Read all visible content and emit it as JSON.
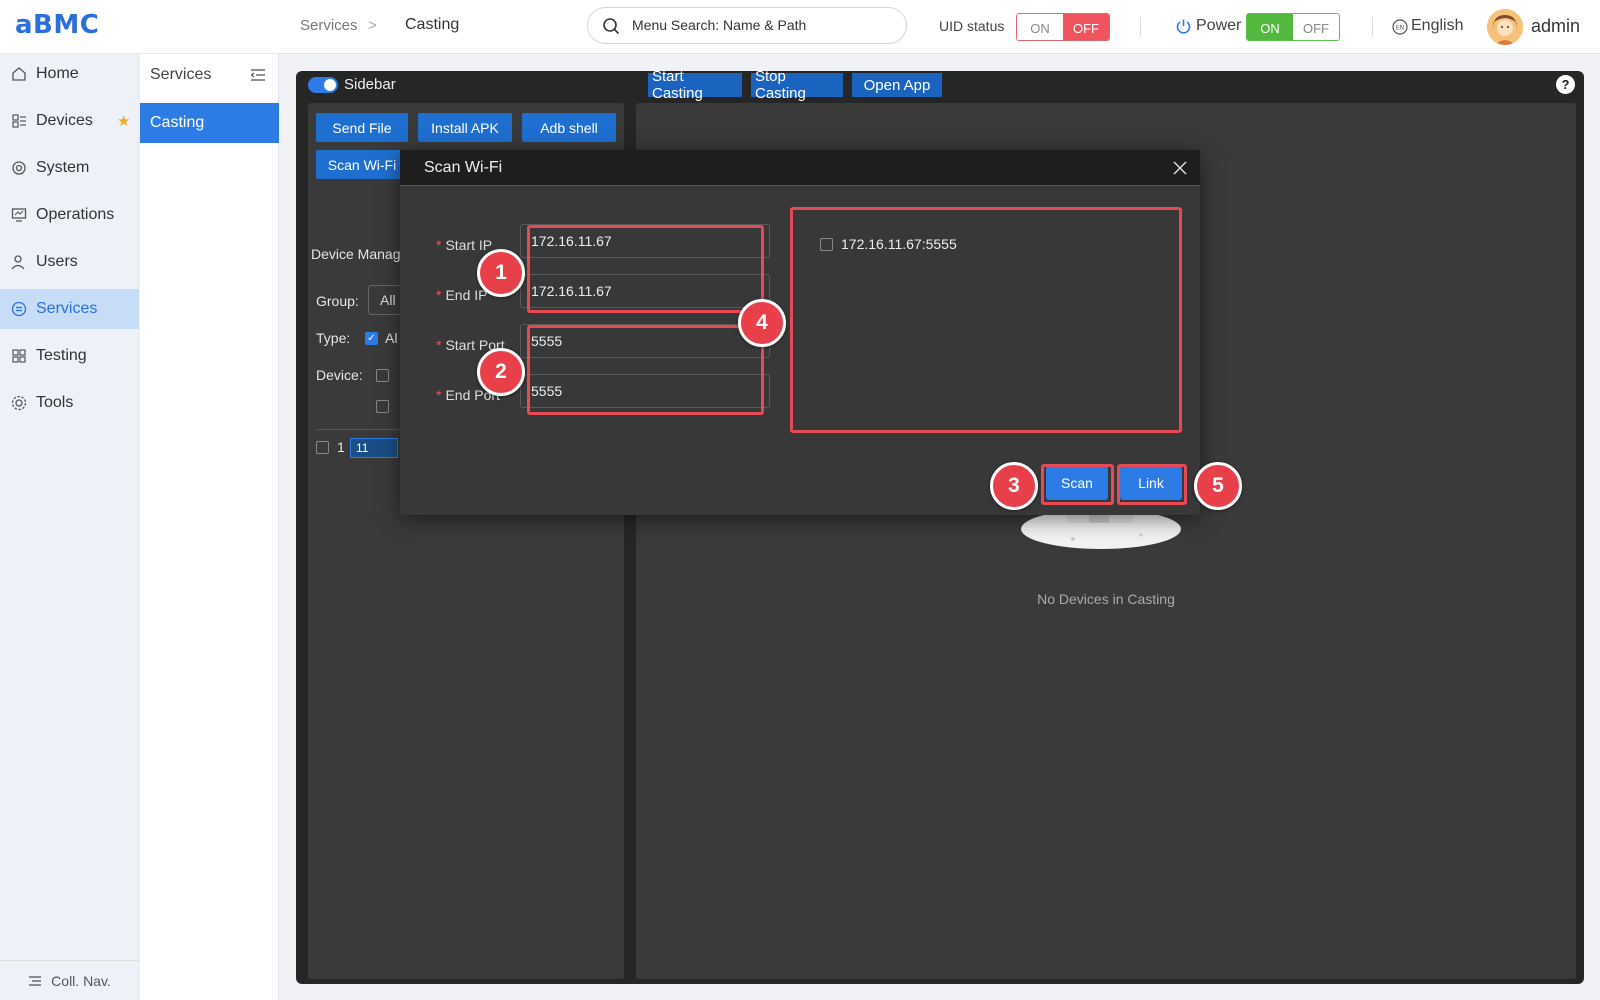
{
  "app": {
    "logo": "aBMC",
    "user": "admin"
  },
  "breadcrumb": {
    "parent": "Services",
    "separator": ">",
    "current": "Casting"
  },
  "search": {
    "text": "Menu Search: Name & Path"
  },
  "uid": {
    "label": "UID status",
    "on": "ON",
    "off": "OFF"
  },
  "power": {
    "label": "Power",
    "on": "ON",
    "off": "OFF"
  },
  "language": {
    "label": "English"
  },
  "nav": {
    "items": [
      {
        "label": "Home",
        "icon": "home-icon"
      },
      {
        "label": "Devices",
        "icon": "devices-icon"
      },
      {
        "label": "System",
        "icon": "system-icon"
      },
      {
        "label": "Operations",
        "icon": "operations-icon"
      },
      {
        "label": "Users",
        "icon": "users-icon"
      },
      {
        "label": "Services",
        "icon": "services-icon"
      },
      {
        "label": "Testing",
        "icon": "testing-icon"
      },
      {
        "label": "Tools",
        "icon": "tools-icon"
      }
    ],
    "collapse_label": "Coll. Nav."
  },
  "subnav": {
    "title": "Services",
    "items": [
      {
        "label": "Casting"
      }
    ]
  },
  "toolbar": {
    "sidebar_label": "Sidebar",
    "start": "Start Casting",
    "stop": "Stop Casting",
    "open_app": "Open App",
    "help": "?"
  },
  "left_pane": {
    "buttons": {
      "send_file": "Send File",
      "install_apk": "Install APK",
      "adb_shell": "Adb shell",
      "scan_wifi": "Scan Wi-Fi"
    },
    "device_manager": "Device Manag",
    "group_label": "Group:",
    "group_value": "All",
    "type_label": "Type:",
    "type_value": "Al",
    "device_label": "Device:",
    "row_index": "1",
    "row_id": "11"
  },
  "right_pane": {
    "empty_text": "No Devices in Casting"
  },
  "dialog": {
    "title": "Scan Wi-Fi",
    "required_mark": "*",
    "fields": [
      {
        "label": "Start IP",
        "value": "172.16.11.67"
      },
      {
        "label": "End IP",
        "value": "172.16.11.67"
      },
      {
        "label": "Start Port",
        "value": "5555"
      },
      {
        "label": "End Port",
        "value": "5555"
      }
    ],
    "results": [
      "172.16.11.67:5555"
    ],
    "scan": "Scan",
    "link": "Link"
  },
  "annotations": [
    "1",
    "2",
    "3",
    "4",
    "5"
  ],
  "colors": {
    "accent": "#2d7ce5",
    "highlight": "#e84a55",
    "off": "#f0555f",
    "on": "#52b83e",
    "panel": "#262626"
  }
}
